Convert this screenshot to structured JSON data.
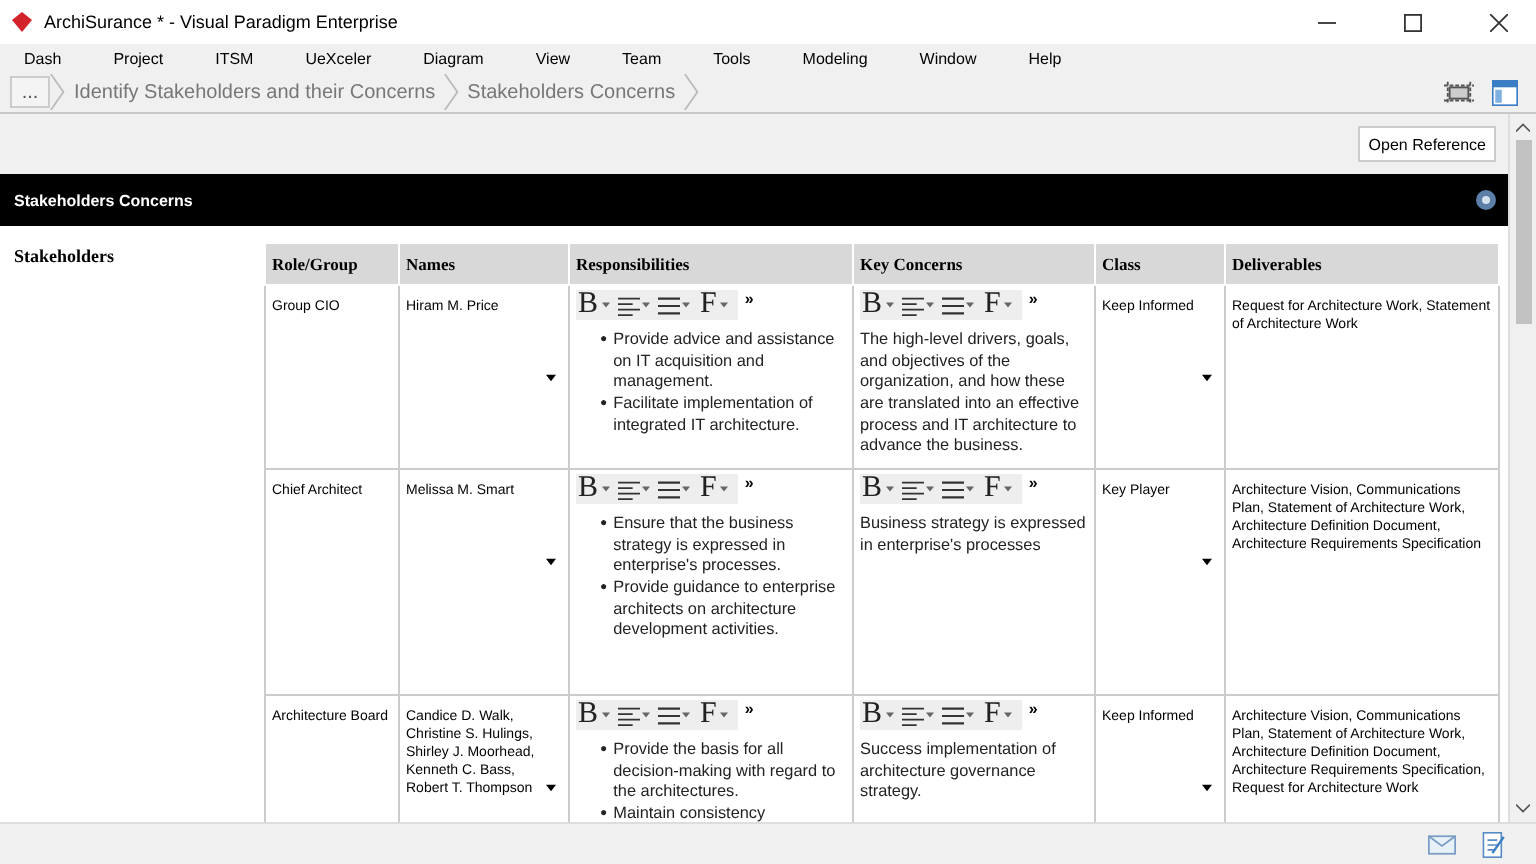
{
  "window": {
    "title": "ArchiSurance * - Visual Paradigm Enterprise"
  },
  "menu": [
    "Dash",
    "Project",
    "ITSM",
    "UeXceler",
    "Diagram",
    "View",
    "Team",
    "Tools",
    "Modeling",
    "Window",
    "Help"
  ],
  "breadcrumb": {
    "more": "...",
    "items": [
      "Identify Stakeholders and their Concerns",
      "Stakeholders Concerns"
    ]
  },
  "open_reference": "Open Reference",
  "section": {
    "title": "Stakeholders Concerns"
  },
  "field_label": "Stakeholders",
  "table": {
    "columns": [
      "Role/Group",
      "Names",
      "Responsibilities",
      "Key Concerns",
      "Class",
      "Deliverables"
    ],
    "rows": [
      {
        "role": "Group CIO",
        "names": "Hiram M. Price",
        "responsibilities": {
          "toolbar": {
            "bold": "B",
            "font": "F",
            "more": "»"
          },
          "marker": "●",
          "bullets": [
            "Provide advice and assistance on IT acquisition and management.",
            "Facilitate implementation of integrated IT architecture."
          ]
        },
        "key_concerns": {
          "toolbar": {
            "bold": "B",
            "font": "F",
            "more": "»"
          },
          "text": "The high-level drivers, goals, and objectives of the organization, and how these are translated into an effective process and IT architecture to advance the business."
        },
        "class": "Keep Informed",
        "deliverables": "Request for Architecture Work, Statement of Architecture Work"
      },
      {
        "role": "Chief Architect",
        "names": "Melissa M. Smart",
        "responsibilities": {
          "toolbar": {
            "bold": "B",
            "font": "F",
            "more": "»"
          },
          "marker": "●",
          "bullets": [
            "Ensure that the business strategy is expressed in enterprise's processes.",
            "Provide guidance to enterprise architects on architecture development activities."
          ]
        },
        "key_concerns": {
          "toolbar": {
            "bold": "B",
            "font": "F",
            "more": "»"
          },
          "text": "Business strategy is expressed in enterprise's processes"
        },
        "class": "Key Player",
        "deliverables": "Architecture Vision, Communications Plan, Statement of Architecture Work, Architecture Definition Document, Architecture Requirements Specification"
      },
      {
        "role": "Architecture Board",
        "names": "Candice D. Walk, Christine S. Hulings, Shirley J. Moorhead, Kenneth C. Bass, Robert T. Thompson",
        "responsibilities": {
          "toolbar": {
            "bold": "B",
            "font": "F",
            "more": "»"
          },
          "marker": "●",
          "bullets": [
            "Provide the basis for all decision-making with regard to the architectures.",
            "Maintain consistency"
          ]
        },
        "key_concerns": {
          "toolbar": {
            "bold": "B",
            "font": "F",
            "more": "»"
          },
          "text": "Success implementation of architecture governance strategy."
        },
        "class": "Keep Informed",
        "deliverables": "Architecture Vision, Communications Plan, Statement of Architecture Work, Architecture Definition Document, Architecture Requirements Specification, Request for Architecture Work"
      }
    ]
  }
}
